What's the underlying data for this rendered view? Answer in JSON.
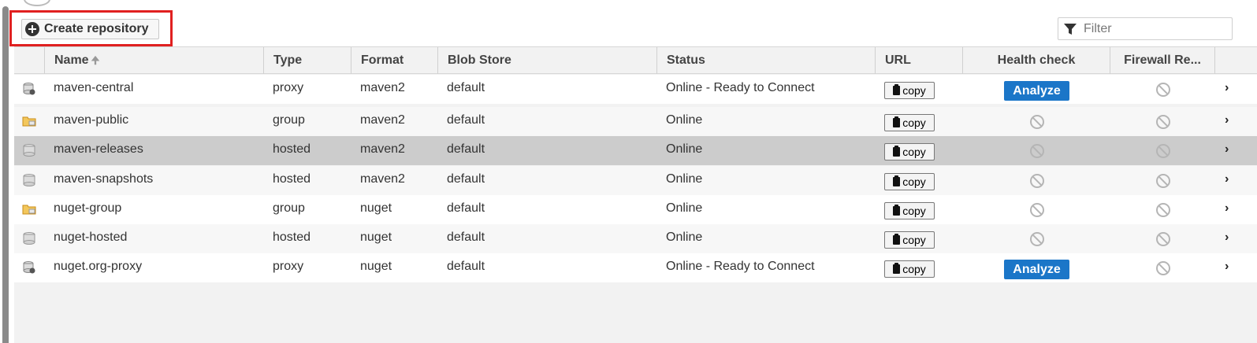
{
  "toolbar": {
    "create_label": "Create repository",
    "filter_placeholder": "Filter"
  },
  "columns": {
    "name": "Name",
    "type": "Type",
    "format": "Format",
    "blob_store": "Blob Store",
    "status": "Status",
    "url": "URL",
    "health_check": "Health check",
    "firewall": "Firewall Re..."
  },
  "rows": [
    {
      "icon": "proxy-repo-icon",
      "name": "maven-central",
      "type": "proxy",
      "format": "maven2",
      "blob": "default",
      "status": "Online - Ready to Connect",
      "copy": "copy",
      "health": "Analyze"
    },
    {
      "icon": "group-repo-icon",
      "name": "maven-public",
      "type": "group",
      "format": "maven2",
      "blob": "default",
      "status": "Online",
      "copy": "copy",
      "health": ""
    },
    {
      "icon": "hosted-repo-icon",
      "name": "maven-releases",
      "type": "hosted",
      "format": "maven2",
      "blob": "default",
      "status": "Online",
      "copy": "copy",
      "health": ""
    },
    {
      "icon": "hosted-repo-icon",
      "name": "maven-snapshots",
      "type": "hosted",
      "format": "maven2",
      "blob": "default",
      "status": "Online",
      "copy": "copy",
      "health": ""
    },
    {
      "icon": "group-repo-icon",
      "name": "nuget-group",
      "type": "group",
      "format": "nuget",
      "blob": "default",
      "status": "Online",
      "copy": "copy",
      "health": ""
    },
    {
      "icon": "hosted-repo-icon",
      "name": "nuget-hosted",
      "type": "hosted",
      "format": "nuget",
      "blob": "default",
      "status": "Online",
      "copy": "copy",
      "health": ""
    },
    {
      "icon": "proxy-repo-icon",
      "name": "nuget.org-proxy",
      "type": "proxy",
      "format": "nuget",
      "blob": "default",
      "status": "Online - Ready to Connect",
      "copy": "copy",
      "health": "Analyze"
    }
  ],
  "selected_row": 2,
  "colors": {
    "accent": "#1b76c8",
    "highlight": "#e02020",
    "selected": "#cccccc"
  }
}
